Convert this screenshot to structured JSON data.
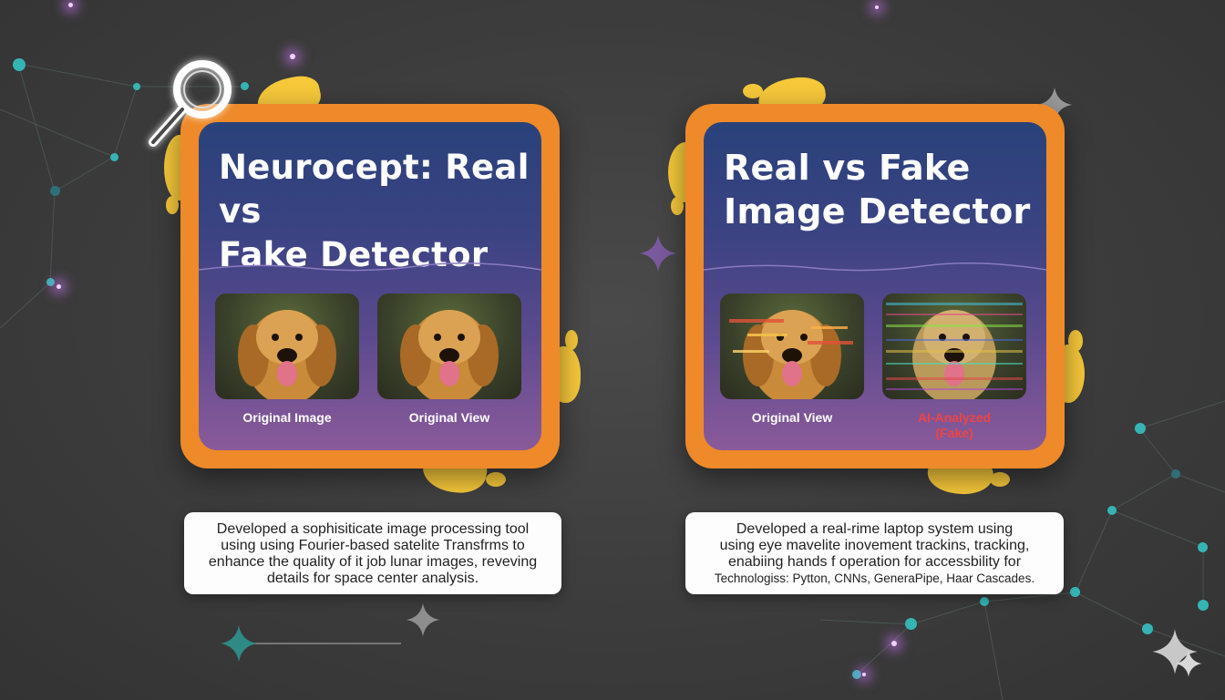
{
  "cards": [
    {
      "title": "Neurocept: Real vs\nFake Detector",
      "images": [
        {
          "caption": "Original Image",
          "style": "clean"
        },
        {
          "caption": "Original View",
          "style": "clean"
        }
      ],
      "description": [
        "Developed a sophisiticate image processing tool",
        "using using Fourier-based satelite Transfrms to",
        "enhance the quality of it job lunar images, reveving",
        "details for space center analysis."
      ]
    },
    {
      "title": "Real vs Fake\nImage Detector",
      "images": [
        {
          "caption": "Original View",
          "style": "glitch"
        },
        {
          "caption": "AI-Analyzed\n(Fake)",
          "style": "noise"
        }
      ],
      "description": [
        "Developed a real-rime laptop system using",
        "using eye mavelite inovement trackins, tracking,",
        "enabiing hands f operation for accessbility for",
        "Technologiss: Pytton, CNNs, GeneraPipe, Haar Cascades."
      ]
    }
  ],
  "icons": [
    "magnifier-icon",
    "sparkle-icon",
    "network-background"
  ],
  "colors": {
    "background": "#3c3c3c",
    "card_frame": "#ee8a2a",
    "blob": "#f6c83a",
    "network_node": "#36b4b4",
    "fake_label": "#ef4444"
  }
}
